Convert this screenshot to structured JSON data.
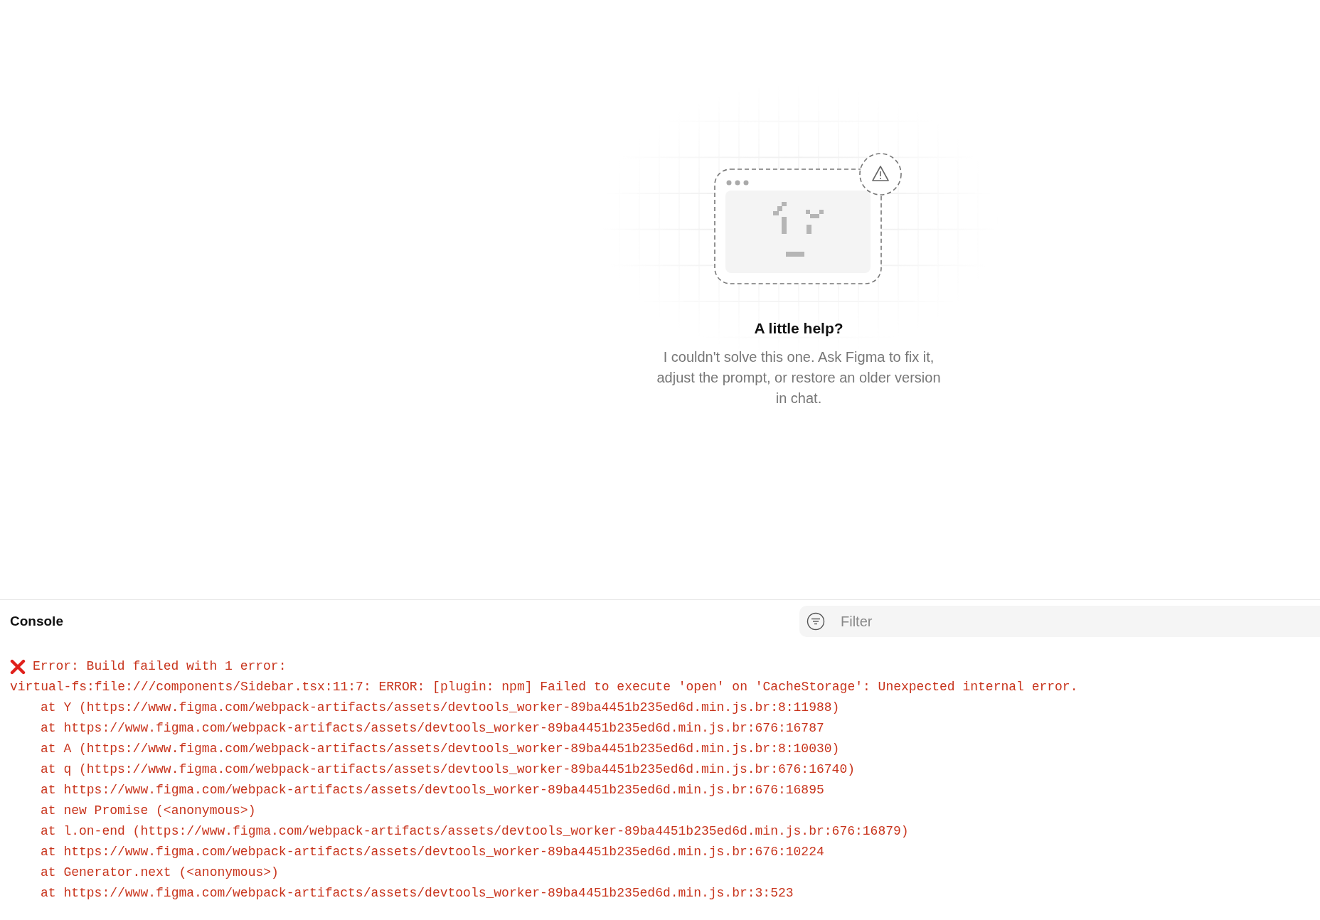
{
  "empty_state": {
    "title": "A little help?",
    "message": "I couldn't solve this one. Ask Figma to fix it, adjust the prompt, or restore an older version in chat."
  },
  "console": {
    "title": "Console",
    "filter": {
      "placeholder": "Filter"
    },
    "lines": [
      {
        "kind": "error",
        "text": "Error: Build failed with 1 error:"
      },
      {
        "kind": "detail",
        "text": "virtual-fs:file:///components/Sidebar.tsx:11:7: ERROR: [plugin: npm] Failed to execute 'open' on 'CacheStorage': Unexpected internal error."
      },
      {
        "kind": "frame",
        "text": "at Y (https://www.figma.com/webpack-artifacts/assets/devtools_worker-89ba4451b235ed6d.min.js.br:8:11988)"
      },
      {
        "kind": "frame",
        "text": "at https://www.figma.com/webpack-artifacts/assets/devtools_worker-89ba4451b235ed6d.min.js.br:676:16787"
      },
      {
        "kind": "frame",
        "text": "at A (https://www.figma.com/webpack-artifacts/assets/devtools_worker-89ba4451b235ed6d.min.js.br:8:10030)"
      },
      {
        "kind": "frame",
        "text": "at q (https://www.figma.com/webpack-artifacts/assets/devtools_worker-89ba4451b235ed6d.min.js.br:676:16740)"
      },
      {
        "kind": "frame",
        "text": "at https://www.figma.com/webpack-artifacts/assets/devtools_worker-89ba4451b235ed6d.min.js.br:676:16895"
      },
      {
        "kind": "frame",
        "text": "at new Promise (<anonymous>)"
      },
      {
        "kind": "frame",
        "text": "at l.on-end (https://www.figma.com/webpack-artifacts/assets/devtools_worker-89ba4451b235ed6d.min.js.br:676:16879)"
      },
      {
        "kind": "frame",
        "text": "at https://www.figma.com/webpack-artifacts/assets/devtools_worker-89ba4451b235ed6d.min.js.br:676:10224"
      },
      {
        "kind": "frame",
        "text": "at Generator.next (<anonymous>)"
      },
      {
        "kind": "frame",
        "text": "at https://www.figma.com/webpack-artifacts/assets/devtools_worker-89ba4451b235ed6d.min.js.br:3:523"
      }
    ]
  }
}
